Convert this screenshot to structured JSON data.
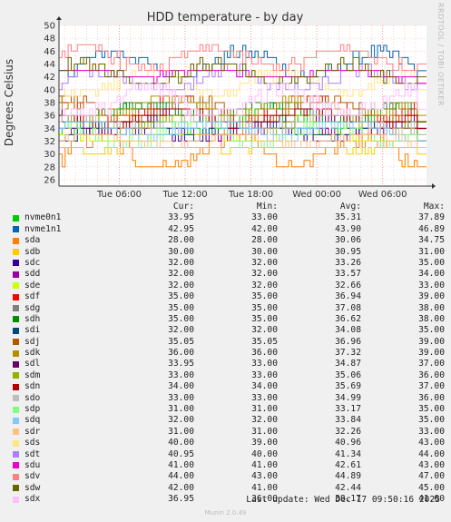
{
  "chart_data": {
    "type": "line",
    "title": "HDD temperature - by day",
    "ylabel": "Degrees Celsius",
    "ylim": [
      25,
      50
    ],
    "yticks": [
      26,
      28,
      30,
      32,
      34,
      36,
      38,
      40,
      42,
      44,
      46,
      48,
      50
    ],
    "x_tick_labels": [
      "Tue 06:00",
      "Tue 12:00",
      "Tue 18:00",
      "Wed 00:00",
      "Wed 06:00"
    ],
    "x_start_hour": 0.5,
    "x_end_hour": 34.0,
    "x_tick_hours": [
      6,
      12,
      18,
      24,
      30
    ],
    "grid": true,
    "side_label": "RRDTOOL / TOBI OETIKER",
    "series": [
      {
        "name": "nvme0n1",
        "color": "#00cc00",
        "cur": "33.95",
        "min": "33.00",
        "avg": "35.31",
        "max": "37.89"
      },
      {
        "name": "nvme1n1",
        "color": "#0066b3",
        "cur": "42.95",
        "min": "42.00",
        "avg": "43.90",
        "max": "46.89"
      },
      {
        "name": "sda",
        "color": "#ff8000",
        "cur": "28.00",
        "min": "28.00",
        "avg": "30.06",
        "max": "34.75"
      },
      {
        "name": "sdb",
        "color": "#ffcc00",
        "cur": "30.00",
        "min": "30.00",
        "avg": "30.95",
        "max": "31.00"
      },
      {
        "name": "sdc",
        "color": "#330099",
        "cur": "32.00",
        "min": "32.00",
        "avg": "33.26",
        "max": "35.00"
      },
      {
        "name": "sdd",
        "color": "#990099",
        "cur": "32.00",
        "min": "32.00",
        "avg": "33.57",
        "max": "34.00"
      },
      {
        "name": "sde",
        "color": "#ccff00",
        "cur": "32.00",
        "min": "32.00",
        "avg": "32.66",
        "max": "33.00"
      },
      {
        "name": "sdf",
        "color": "#ff0000",
        "cur": "35.00",
        "min": "35.00",
        "avg": "36.94",
        "max": "39.00"
      },
      {
        "name": "sdg",
        "color": "#808080",
        "cur": "35.00",
        "min": "35.00",
        "avg": "37.08",
        "max": "38.00"
      },
      {
        "name": "sdh",
        "color": "#008f00",
        "cur": "35.00",
        "min": "35.00",
        "avg": "36.62",
        "max": "38.00"
      },
      {
        "name": "sdi",
        "color": "#00487d",
        "cur": "32.00",
        "min": "32.00",
        "avg": "34.08",
        "max": "35.00"
      },
      {
        "name": "sdj",
        "color": "#b35a00",
        "cur": "35.05",
        "min": "35.05",
        "avg": "36.96",
        "max": "39.00"
      },
      {
        "name": "sdk",
        "color": "#b38f00",
        "cur": "36.00",
        "min": "36.00",
        "avg": "37.32",
        "max": "39.00"
      },
      {
        "name": "sdl",
        "color": "#6b006b",
        "cur": "33.95",
        "min": "33.00",
        "avg": "34.87",
        "max": "37.00"
      },
      {
        "name": "sdm",
        "color": "#8fb300",
        "cur": "33.00",
        "min": "33.00",
        "avg": "35.06",
        "max": "36.00"
      },
      {
        "name": "sdn",
        "color": "#b30000",
        "cur": "34.00",
        "min": "34.00",
        "avg": "35.69",
        "max": "37.00"
      },
      {
        "name": "sdo",
        "color": "#bebebe",
        "cur": "33.00",
        "min": "33.00",
        "avg": "34.99",
        "max": "36.00"
      },
      {
        "name": "sdp",
        "color": "#80ff80",
        "cur": "31.00",
        "min": "31.00",
        "avg": "33.17",
        "max": "35.00"
      },
      {
        "name": "sdq",
        "color": "#80c9ff",
        "cur": "32.00",
        "min": "32.00",
        "avg": "33.84",
        "max": "35.00"
      },
      {
        "name": "sdr",
        "color": "#ffc080",
        "cur": "31.00",
        "min": "31.00",
        "avg": "32.26",
        "max": "33.00"
      },
      {
        "name": "sds",
        "color": "#ffe680",
        "cur": "40.00",
        "min": "39.00",
        "avg": "40.96",
        "max": "43.00"
      },
      {
        "name": "sdt",
        "color": "#aa80ff",
        "cur": "40.95",
        "min": "40.00",
        "avg": "41.34",
        "max": "44.00"
      },
      {
        "name": "sdu",
        "color": "#ee00cc",
        "cur": "41.00",
        "min": "41.00",
        "avg": "42.61",
        "max": "43.00"
      },
      {
        "name": "sdv",
        "color": "#ff8080",
        "cur": "44.00",
        "min": "43.00",
        "avg": "44.89",
        "max": "47.00"
      },
      {
        "name": "sdw",
        "color": "#666600",
        "cur": "42.00",
        "min": "41.00",
        "avg": "42.44",
        "max": "45.00"
      },
      {
        "name": "sdx",
        "color": "#ffbfff",
        "cur": "36.95",
        "min": "36.00",
        "avg": "38.17",
        "max": "41.00"
      }
    ]
  },
  "legend_headers": {
    "cur": "Cur:",
    "min": "Min:",
    "avg": "Avg:",
    "max": "Max:"
  },
  "last_update": "Last update: Wed Dec 17 09:50:16 2025",
  "version": "Munin 2.0.49"
}
